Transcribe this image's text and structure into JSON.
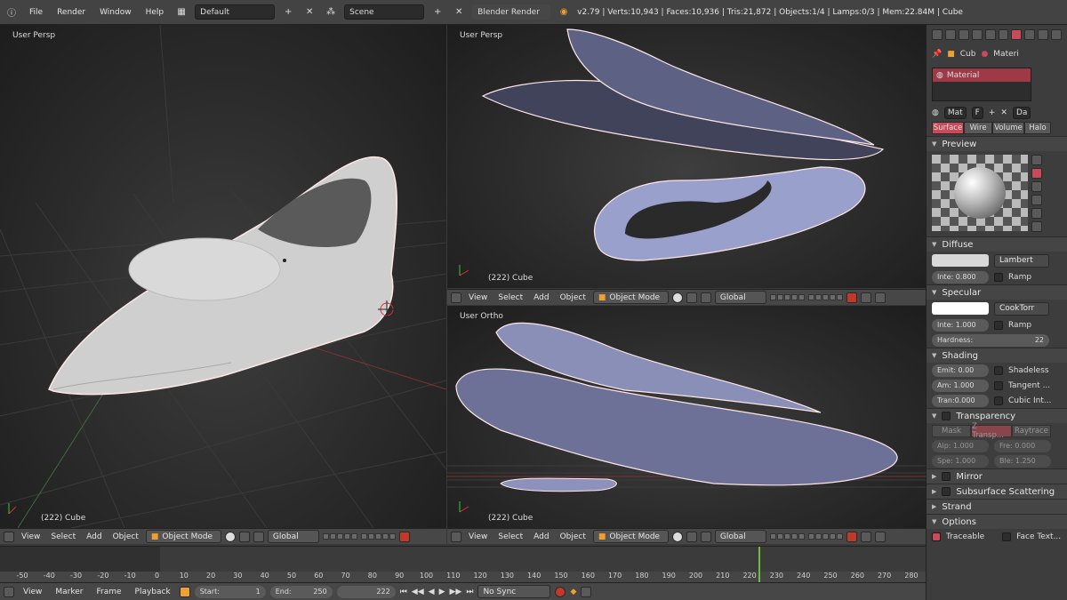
{
  "topbar": {
    "menus": [
      "File",
      "Render",
      "Window",
      "Help"
    ],
    "screen": "Default",
    "scene": "Scene",
    "engine": "Blender Render",
    "stats": "v2.79 | Verts:10,943 | Faces:10,936 | Tris:21,872 | Objects:1/4 | Lamps:0/3 | Mem:22.84M | Cube"
  },
  "viewports": [
    {
      "label": "User Persp",
      "object": "(222) Cube"
    },
    {
      "label": "User Persp",
      "object": "(222) Cube"
    },
    {
      "label": "User Ortho",
      "object": "(222) Cube"
    }
  ],
  "viewheader": {
    "menus": [
      "View",
      "Select",
      "Add",
      "Object"
    ],
    "mode": "Object Mode",
    "orientation": "Global"
  },
  "props": {
    "context": [
      "Cub",
      "Materi"
    ],
    "slot": "Material",
    "mat_name": "Mat",
    "fake": "F",
    "data": "Da",
    "tabs": [
      "Surface",
      "Wire",
      "Volume",
      "Halo"
    ],
    "preview": "Preview",
    "diffuse": {
      "title": "Diffuse",
      "shader": "Lambert",
      "inte": "Inte: 0.800",
      "ramp": "Ramp",
      "color": "#d8d8d8"
    },
    "specular": {
      "title": "Specular",
      "shader": "CookTorr",
      "inte": "Inte: 1.000",
      "ramp": "Ramp",
      "hardness_label": "Hardness:",
      "hardness": "22",
      "color": "#ffffff"
    },
    "shading": {
      "title": "Shading",
      "emit": "Emit: 0.00",
      "shadeless": "Shadeless",
      "amb": "Am: 1.000",
      "tangent": "Tangent ...",
      "tran": "Tran:0.000",
      "cubic": "Cubic Int..."
    },
    "transparency": {
      "title": "Transparency",
      "modes": [
        "Mask",
        "Z Transp...",
        "Raytrace"
      ],
      "alpha": "Alp: 1.000",
      "fresnel": "Fre: 0.000",
      "spec": "Spe: 1.000",
      "blend": "Ble: 1.250"
    },
    "closed": [
      "Mirror",
      "Subsurface Scattering",
      "Strand"
    ],
    "options": {
      "title": "Options",
      "traceable": "Traceable",
      "face_tex": "Face Text..."
    }
  },
  "timeline": {
    "ticks": [
      "-50",
      "-40",
      "-30",
      "-20",
      "-10",
      "0",
      "10",
      "20",
      "30",
      "40",
      "50",
      "60",
      "70",
      "80",
      "90",
      "100",
      "110",
      "120",
      "130",
      "140",
      "150",
      "160",
      "170",
      "180",
      "190",
      "200",
      "210",
      "220",
      "230",
      "240",
      "250",
      "260",
      "270",
      "280"
    ],
    "menus": [
      "View",
      "Marker",
      "Frame",
      "Playback"
    ],
    "start_label": "Start:",
    "start": "1",
    "end_label": "End:",
    "end": "250",
    "current": "222",
    "sync": "No Sync"
  },
  "colors": {
    "accent": "#c0392b",
    "selected_tab": "#c94a5a",
    "object_outline": "#ffe6e6"
  }
}
